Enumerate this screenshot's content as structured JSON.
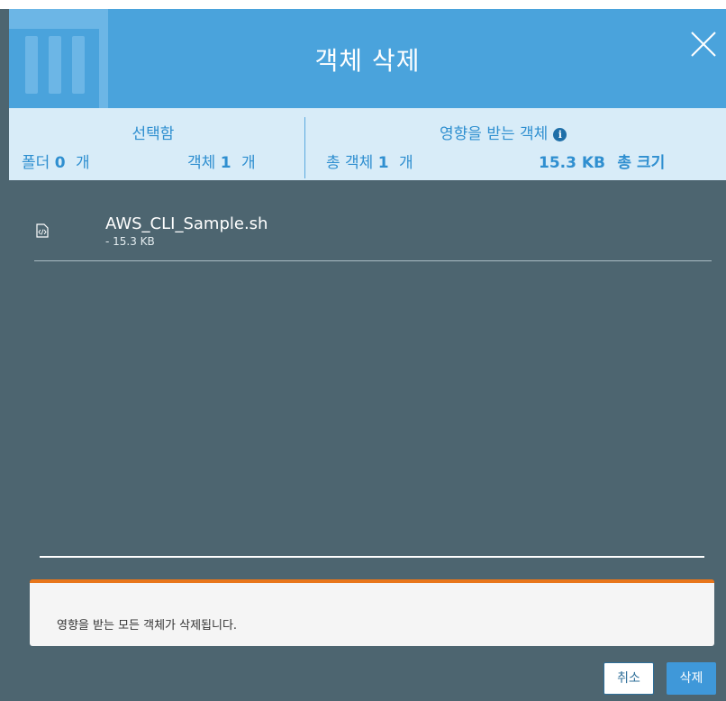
{
  "dialog": {
    "title": "객체 삭제"
  },
  "summary": {
    "selected_title": "선택함",
    "folders_label": "폴더",
    "folders_count": "0",
    "folders_unit": "개",
    "objects_label": "객체",
    "objects_count": "1",
    "objects_unit": "개",
    "affected_title": "영향을 받는 객체",
    "total_objects_label": "총 객체",
    "total_objects_count": "1",
    "total_objects_unit": "개",
    "total_size_value": "15.3 KB",
    "total_size_label": "총 크기"
  },
  "files": [
    {
      "name": "AWS_CLI_Sample.sh",
      "size": "- 15.3 KB",
      "icon": "code-file-icon"
    }
  ],
  "alert": {
    "message": "영향을 받는 모든 객체가 삭제됩니다."
  },
  "buttons": {
    "cancel": "취소",
    "delete": "삭제"
  },
  "colors": {
    "header": "#4aa3dc",
    "summary_bg": "#d8ecf8",
    "body_bg": "#4d6570",
    "alert_accent": "#e8761b",
    "primary": "#3f98d9"
  }
}
